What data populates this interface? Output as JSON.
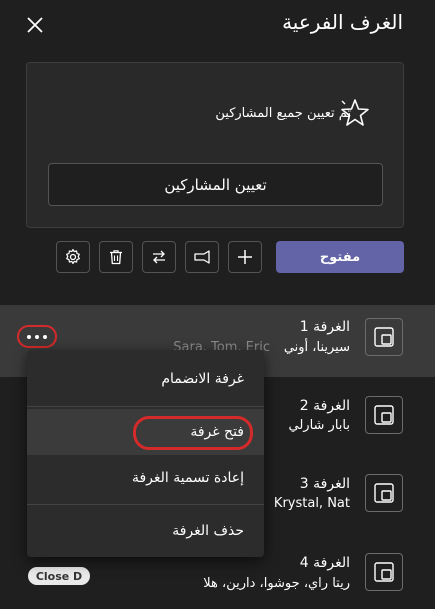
{
  "header": {
    "title": "الغرف الفرعية"
  },
  "assign": {
    "status_text": "تم تعيين جميع المشاركين",
    "button_label": "تعيين المشاركين"
  },
  "toolbar": {
    "open_label": "مفتوح"
  },
  "rooms": [
    {
      "name": "الغرفة 1",
      "people": "سيرينا، أوني",
      "people_faded": "Sara, Tom, Eric"
    },
    {
      "name": "الغرفة 2",
      "people": "بابار شارلي"
    },
    {
      "name": "الغرفة 3",
      "people": "Krystal, Nat"
    },
    {
      "name": "الغرفة 4",
      "people": "ريتا راي، جوشوا، دارين، هلا"
    }
  ],
  "room_badge": "Close D",
  "context_menu": {
    "items": [
      {
        "label": "غرفة الانضمام"
      },
      {
        "label": "فتح غرفة"
      },
      {
        "label": "إعادة تسمية الغرفة"
      },
      {
        "label": "حذف الغرفة"
      }
    ]
  },
  "colors": {
    "background": "#1f1f1f",
    "accent": "#6264a7",
    "highlight": "#d52a2a"
  }
}
